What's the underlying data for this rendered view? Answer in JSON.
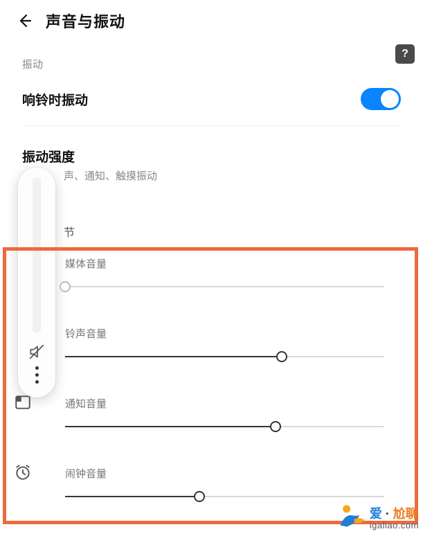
{
  "header": {
    "title": "声音与振动"
  },
  "vibration": {
    "section_label": "振动",
    "ring_vibrate_label": "响铃时振动",
    "ring_vibrate_on": true,
    "intensity_title": "振动强度",
    "intensity_sub": "声、通知、触摸振动"
  },
  "adjust_label": "节",
  "volumes": {
    "media": {
      "label": "媒体音量",
      "value": 0,
      "max": 100
    },
    "ring": {
      "label": "铃声音量",
      "value": 68,
      "max": 100
    },
    "notify": {
      "label": "通知音量",
      "value": 66,
      "max": 100
    },
    "alarm": {
      "label": "闹钟音量",
      "value": 42,
      "max": 100
    }
  },
  "watermark": {
    "brand_cn": "爱·尬聊",
    "domain": "igaliao.com"
  },
  "badge": "?"
}
